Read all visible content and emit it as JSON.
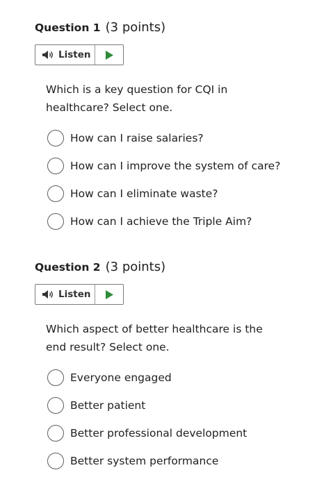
{
  "questions": [
    {
      "title": "Question 1",
      "points": "(3 points)",
      "listen_label": "Listen",
      "text": "Which is a key question for CQI in healthcare? Select one.",
      "options": [
        "How can I raise salaries?",
        "How can I improve the system of care?",
        "How can I eliminate waste?",
        "How can I achieve the Triple Aim?"
      ]
    },
    {
      "title": "Question 2",
      "points": "(3 points)",
      "listen_label": "Listen",
      "text": "Which aspect of better healthcare is the end result? Select one.",
      "options": [
        "Everyone engaged",
        "Better patient",
        "Better professional development",
        "Better system performance"
      ]
    }
  ],
  "icons": {
    "listen": "speaker-icon",
    "play": "play-icon"
  },
  "colors": {
    "play_icon": "#2e8b3a",
    "speaker_icon": "#333333"
  }
}
